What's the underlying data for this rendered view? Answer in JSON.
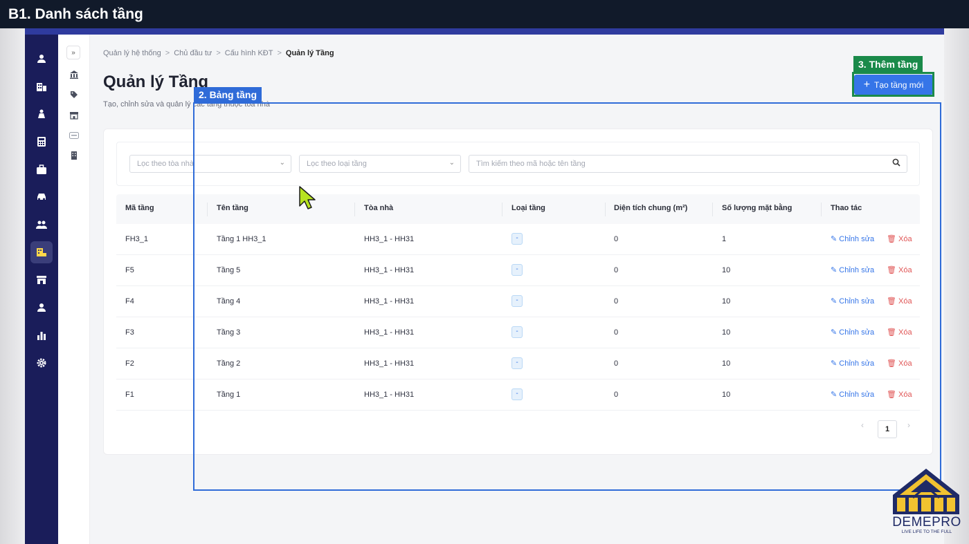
{
  "banner": {
    "title": "B1. Danh sách tầng"
  },
  "breadcrumb": {
    "items": [
      "Quản lý hệ thống",
      "Chủ đầu tư",
      "Cấu hình KĐT"
    ],
    "current": "Quản lý Tầng",
    "separator": ">"
  },
  "page": {
    "title": "Quản lý Tầng",
    "subtitle": "Tạo, chỉnh sửa và quản lý các tầng thuộc tòa nhà"
  },
  "actions": {
    "create_label": "Tạo tầng mới"
  },
  "filters": {
    "building_placeholder": "Lọc theo tòa nhà",
    "floor_type_placeholder": "Lọc theo loại tầng",
    "search_placeholder": "Tìm kiếm theo mã hoặc tên tầng"
  },
  "table": {
    "columns": [
      "Mã tầng",
      "Tên tầng",
      "Tòa nhà",
      "Loại tầng",
      "Diện tích chung (m²)",
      "Số lượng mặt bằng",
      "Thao tác"
    ],
    "edit_label": "Chỉnh sửa",
    "delete_label": "Xóa",
    "rows": [
      {
        "code": "FH3_1",
        "name": "Tầng 1 HH3_1",
        "building": "HH3_1 - HH31",
        "type": "-",
        "area": "0",
        "units": "1"
      },
      {
        "code": "F5",
        "name": "Tầng 5",
        "building": "HH3_1 - HH31",
        "type": "-",
        "area": "0",
        "units": "10"
      },
      {
        "code": "F4",
        "name": "Tầng 4",
        "building": "HH3_1 - HH31",
        "type": "-",
        "area": "0",
        "units": "10"
      },
      {
        "code": "F3",
        "name": "Tầng 3",
        "building": "HH3_1 - HH31",
        "type": "-",
        "area": "0",
        "units": "10"
      },
      {
        "code": "F2",
        "name": "Tầng 2",
        "building": "HH3_1 - HH31",
        "type": "-",
        "area": "0",
        "units": "10"
      },
      {
        "code": "F1",
        "name": "Tầng 1",
        "building": "HH3_1 - HH31",
        "type": "-",
        "area": "0",
        "units": "10"
      }
    ]
  },
  "pagination": {
    "current_page": "1",
    "prev": "‹",
    "next": "›"
  },
  "annotations": {
    "table_label": "2. Bảng tầng",
    "create_label": "3. Thêm tầng"
  },
  "logo": {
    "name": "DEMEPRO",
    "slogan": "LIVE LIFE TO THE FULL"
  },
  "colors": {
    "rail_bg": "#1a1d5a",
    "primary": "#3575e8",
    "danger": "#e05555",
    "annotation_blue": "#2f6bd8",
    "annotation_green": "#1a8a4a",
    "logo_gold": "#f2c230",
    "logo_navy": "#1f2a66"
  },
  "icons": {
    "rail": [
      "user-icon",
      "building-icon",
      "investor-icon",
      "calculator-icon",
      "briefcase-icon",
      "car-icon",
      "users-icon",
      "floor-plan-icon",
      "store-icon",
      "person-icon",
      "chart-icon",
      "settings-icon"
    ],
    "subnav": [
      "bank-icon",
      "tag-icon",
      "store-icon",
      "parking-icon",
      "tower-icon"
    ]
  }
}
